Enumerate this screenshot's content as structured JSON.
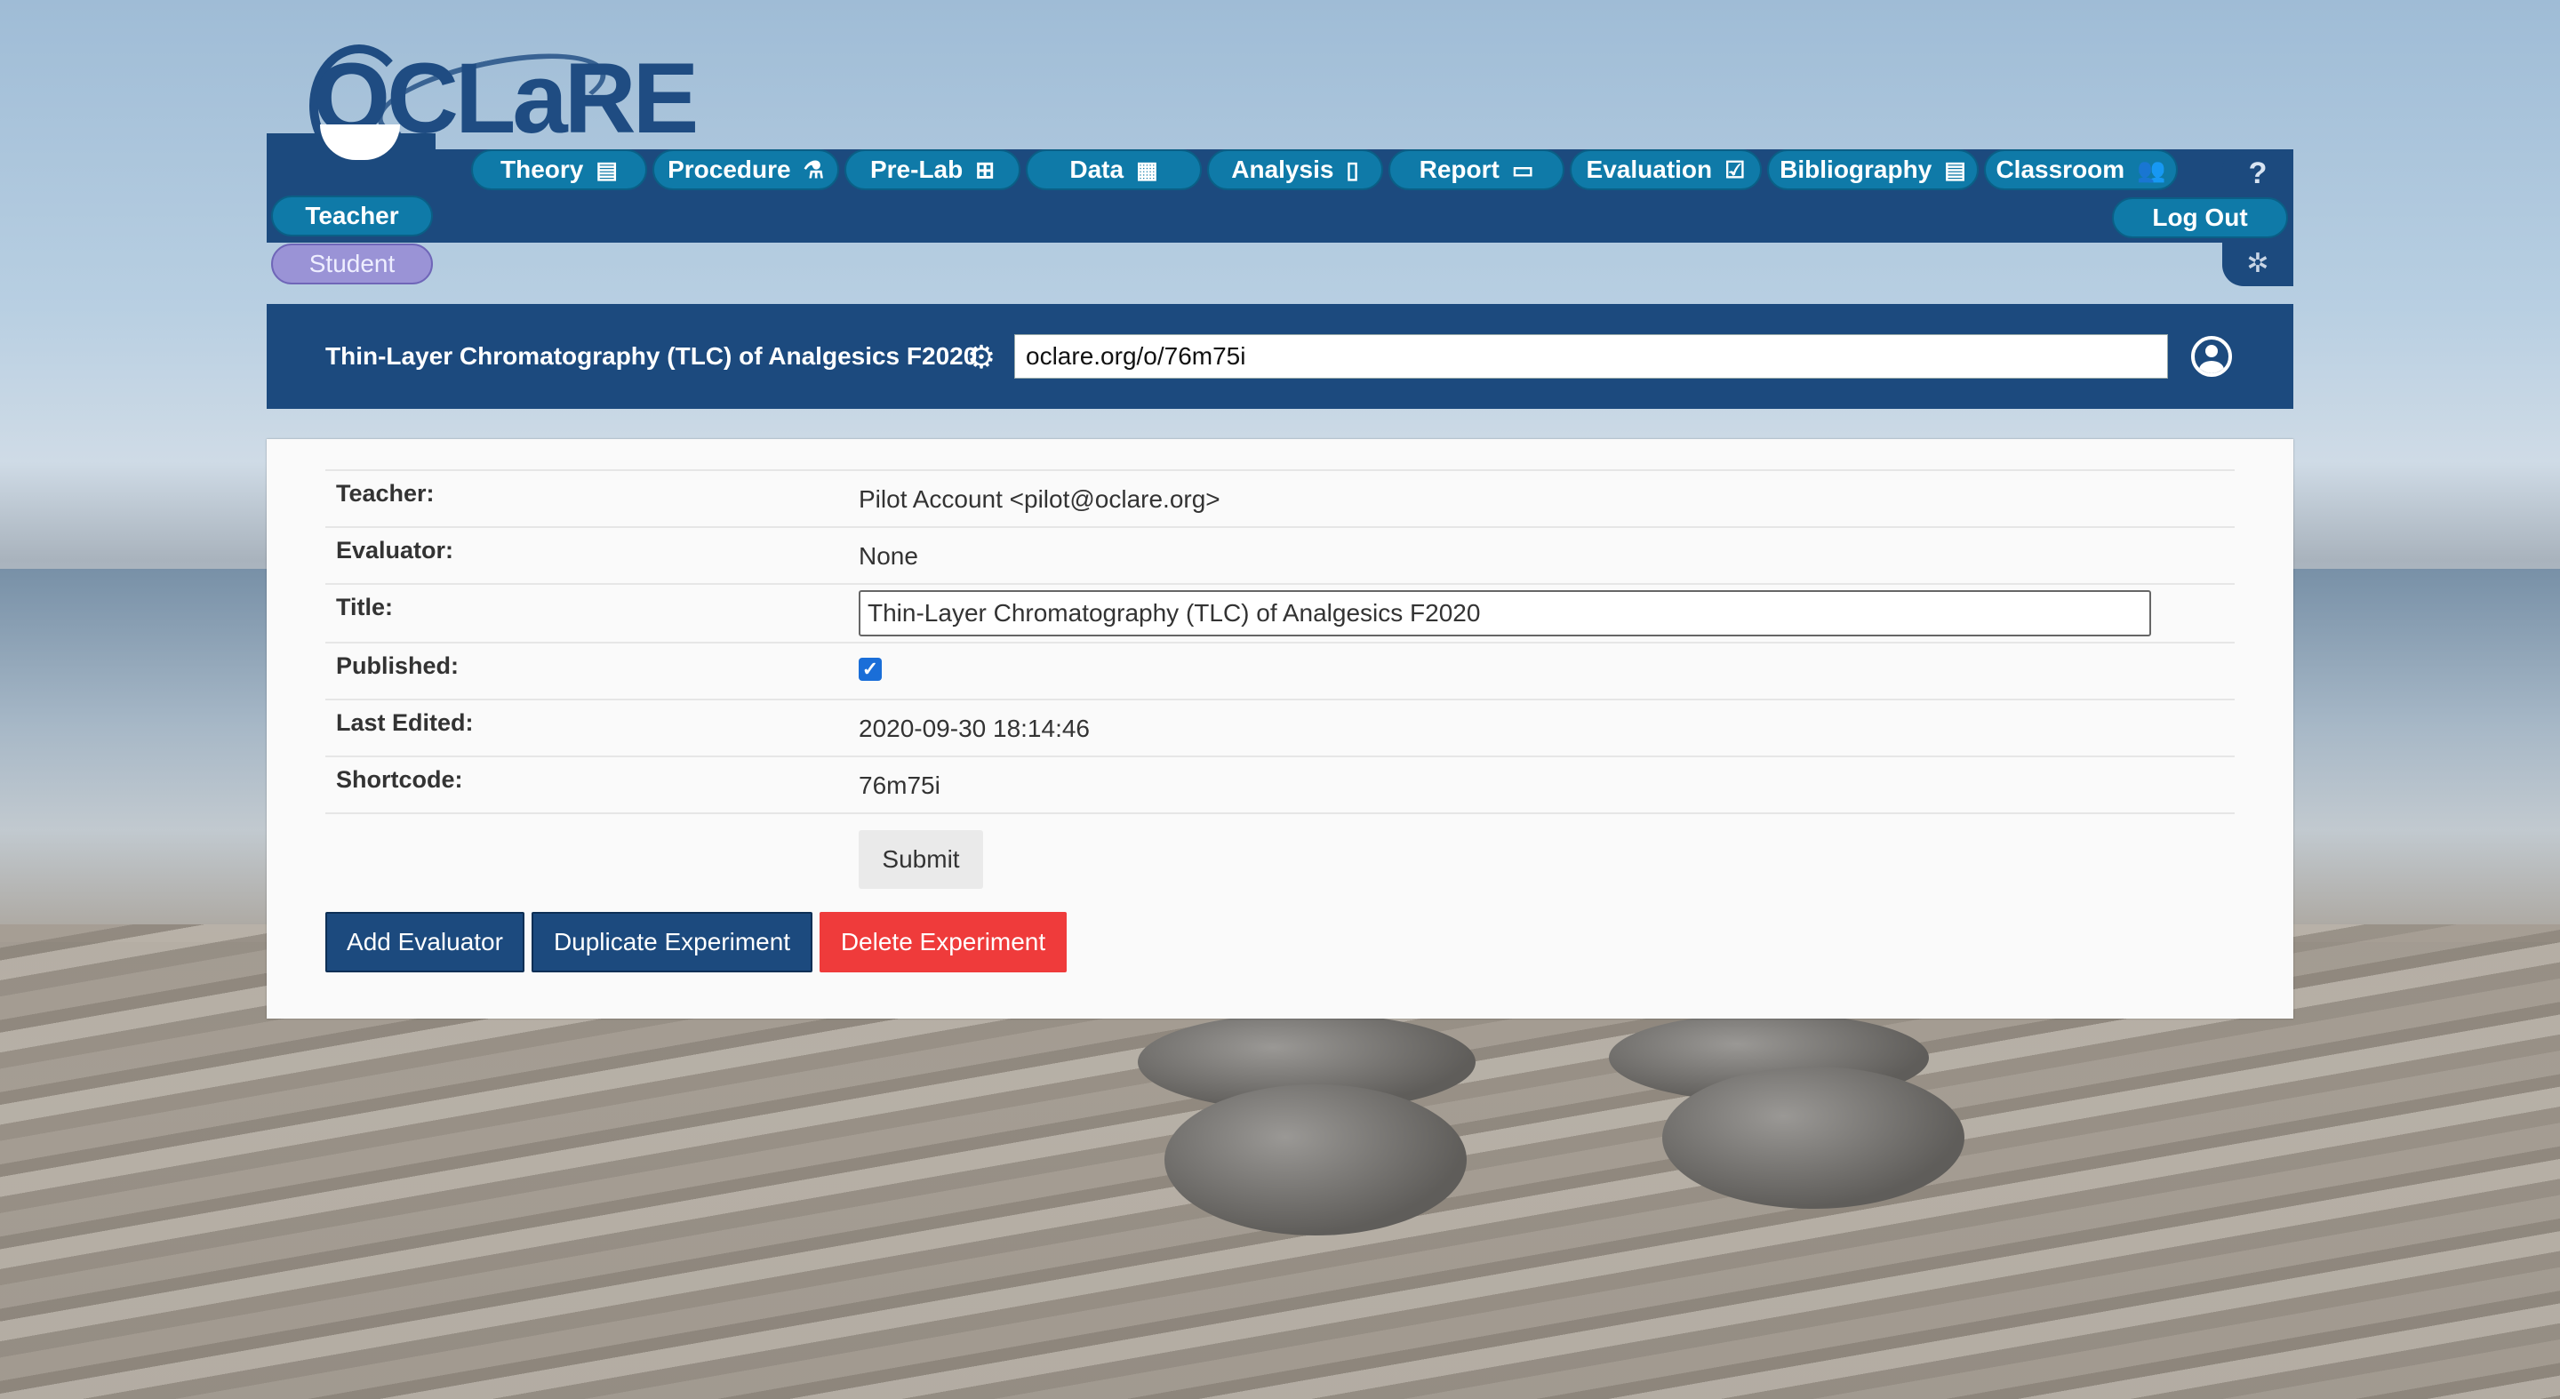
{
  "logo": {
    "text": "OCLaRE"
  },
  "nav": {
    "tabs": [
      {
        "label": "Theory",
        "icon": "▤"
      },
      {
        "label": "Procedure",
        "icon": "⚗"
      },
      {
        "label": "Pre-Lab",
        "icon": "⊞"
      },
      {
        "label": "Data",
        "icon": "▦"
      },
      {
        "label": "Analysis",
        "icon": "▯"
      },
      {
        "label": "Report",
        "icon": "▭"
      },
      {
        "label": "Evaluation",
        "icon": "☑"
      },
      {
        "label": "Bibliography",
        "icon": "▤"
      },
      {
        "label": "Classroom",
        "icon": "👥"
      }
    ],
    "roles": {
      "teacher": "Teacher",
      "student": "Student"
    },
    "help": "?",
    "logout": "Log Out",
    "bug_icon": "✲"
  },
  "titlebar": {
    "experiment_title": "Thin-Layer Chromatography (TLC) of Analgesics F2020",
    "gear_icon": "⚙",
    "share_url": "oclare.org/o/76m75i"
  },
  "details": {
    "teacher_label": "Teacher:",
    "teacher_value": "Pilot Account <pilot@oclare.org>",
    "evaluator_label": "Evaluator:",
    "evaluator_value": "None",
    "title_label": "Title:",
    "title_value": "Thin-Layer Chromatography (TLC) of Analgesics F2020",
    "published_label": "Published:",
    "published_checked": true,
    "check_mark": "✓",
    "last_edited_label": "Last Edited:",
    "last_edited_value": "2020-09-30 18:14:46",
    "shortcode_label": "Shortcode:",
    "shortcode_value": "76m75i",
    "submit_label": "Submit"
  },
  "actions": {
    "add_evaluator": "Add Evaluator",
    "duplicate_experiment": "Duplicate Experiment",
    "delete_experiment": "Delete Experiment"
  },
  "colors": {
    "navy": "#1c4a7e",
    "tab_blue": "#0f7aa8",
    "student_purple": "#9a93d6",
    "delete_red": "#ef3b3b",
    "checkbox_blue": "#1a6ed8"
  }
}
